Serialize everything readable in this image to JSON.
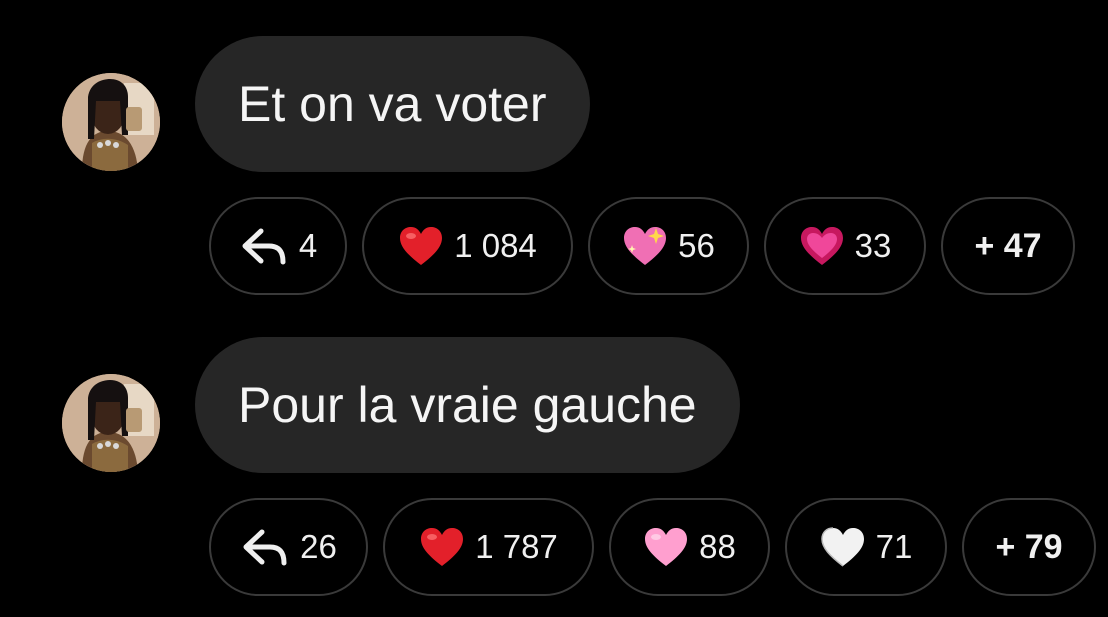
{
  "messages": [
    {
      "text": "Et on va voter",
      "reply_count": "4",
      "reactions": [
        {
          "icon": "red-heart-icon",
          "count": "1 084"
        },
        {
          "icon": "sparkling-heart-icon",
          "count": "56"
        },
        {
          "icon": "beating-heart-icon",
          "count": "33"
        }
      ],
      "more": "+ 47"
    },
    {
      "text": "Pour la vraie gauche",
      "reply_count": "26",
      "reactions": [
        {
          "icon": "red-heart-icon",
          "count": "1 787"
        },
        {
          "icon": "pink-heart-icon",
          "count": "88"
        },
        {
          "icon": "white-heart-icon",
          "count": "71"
        }
      ],
      "more": "+ 79"
    }
  ],
  "colors": {
    "background": "#000000",
    "bubble": "#262626",
    "chip_border": "#3a3a3a",
    "text": "#f5f5f5"
  }
}
